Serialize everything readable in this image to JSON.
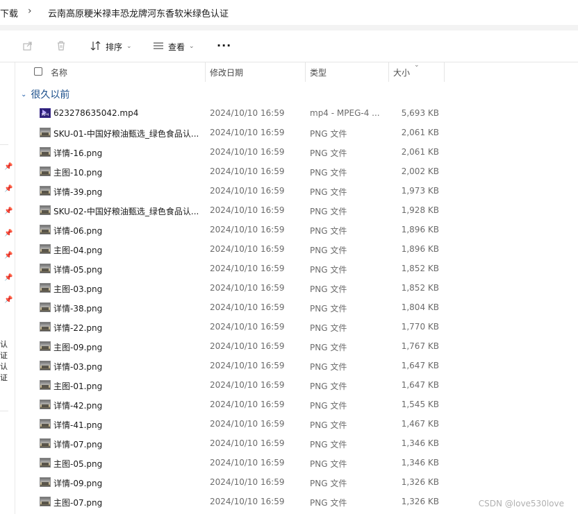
{
  "address": {
    "crumbs": [
      "下载",
      "云南高原粳米禄丰恐龙牌河东香软米绿色认证"
    ],
    "separator": "›"
  },
  "toolbar": {
    "share_icon": "share-icon",
    "delete_icon": "trash-icon",
    "sort_label": "排序",
    "view_label": "查看",
    "more_label": "···"
  },
  "nav": {
    "truncated_items": [
      "认证",
      "认证"
    ]
  },
  "columns": {
    "name": "名称",
    "date": "修改日期",
    "type": "类型",
    "size": "大小"
  },
  "group": {
    "label": "很久以前"
  },
  "files": [
    {
      "name": "623278635042.mp4",
      "date": "2024/10/10 16:59",
      "type": "mp4 - MPEG-4 ...",
      "size": "5,693 KB",
      "icon": "mp4"
    },
    {
      "name": "SKU-01-中国好粮油甄选_绿色食品认...",
      "date": "2024/10/10 16:59",
      "type": "PNG 文件",
      "size": "2,061 KB",
      "icon": "png"
    },
    {
      "name": "详情-16.png",
      "date": "2024/10/10 16:59",
      "type": "PNG 文件",
      "size": "2,061 KB",
      "icon": "png"
    },
    {
      "name": "主图-10.png",
      "date": "2024/10/10 16:59",
      "type": "PNG 文件",
      "size": "2,002 KB",
      "icon": "png"
    },
    {
      "name": "详情-39.png",
      "date": "2024/10/10 16:59",
      "type": "PNG 文件",
      "size": "1,973 KB",
      "icon": "png"
    },
    {
      "name": "SKU-02-中国好粮油甄选_绿色食品认...",
      "date": "2024/10/10 16:59",
      "type": "PNG 文件",
      "size": "1,928 KB",
      "icon": "png"
    },
    {
      "name": "详情-06.png",
      "date": "2024/10/10 16:59",
      "type": "PNG 文件",
      "size": "1,896 KB",
      "icon": "png"
    },
    {
      "name": "主图-04.png",
      "date": "2024/10/10 16:59",
      "type": "PNG 文件",
      "size": "1,896 KB",
      "icon": "png"
    },
    {
      "name": "详情-05.png",
      "date": "2024/10/10 16:59",
      "type": "PNG 文件",
      "size": "1,852 KB",
      "icon": "png"
    },
    {
      "name": "主图-03.png",
      "date": "2024/10/10 16:59",
      "type": "PNG 文件",
      "size": "1,852 KB",
      "icon": "png"
    },
    {
      "name": "详情-38.png",
      "date": "2024/10/10 16:59",
      "type": "PNG 文件",
      "size": "1,804 KB",
      "icon": "png"
    },
    {
      "name": "详情-22.png",
      "date": "2024/10/10 16:59",
      "type": "PNG 文件",
      "size": "1,770 KB",
      "icon": "png"
    },
    {
      "name": "主图-09.png",
      "date": "2024/10/10 16:59",
      "type": "PNG 文件",
      "size": "1,767 KB",
      "icon": "png"
    },
    {
      "name": "详情-03.png",
      "date": "2024/10/10 16:59",
      "type": "PNG 文件",
      "size": "1,647 KB",
      "icon": "png"
    },
    {
      "name": "主图-01.png",
      "date": "2024/10/10 16:59",
      "type": "PNG 文件",
      "size": "1,647 KB",
      "icon": "png"
    },
    {
      "name": "详情-42.png",
      "date": "2024/10/10 16:59",
      "type": "PNG 文件",
      "size": "1,545 KB",
      "icon": "png"
    },
    {
      "name": "详情-41.png",
      "date": "2024/10/10 16:59",
      "type": "PNG 文件",
      "size": "1,467 KB",
      "icon": "png"
    },
    {
      "name": "详情-07.png",
      "date": "2024/10/10 16:59",
      "type": "PNG 文件",
      "size": "1,346 KB",
      "icon": "png"
    },
    {
      "name": "主图-05.png",
      "date": "2024/10/10 16:59",
      "type": "PNG 文件",
      "size": "1,346 KB",
      "icon": "png"
    },
    {
      "name": "详情-09.png",
      "date": "2024/10/10 16:59",
      "type": "PNG 文件",
      "size": "1,326 KB",
      "icon": "png"
    },
    {
      "name": "主图-07.png",
      "date": "2024/10/10 16:59",
      "type": "PNG 文件",
      "size": "1,326 KB",
      "icon": "png"
    }
  ],
  "watermark": "CSDN @love530love",
  "colors": {
    "group_label": "#1a4e8a",
    "secondary_text": "#6b6b6b",
    "divider": "#e5e5e5"
  }
}
